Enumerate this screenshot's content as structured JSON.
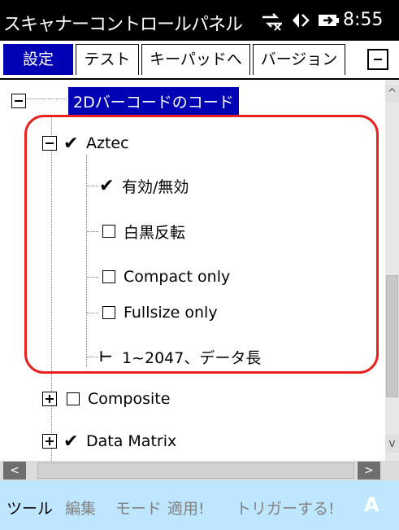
{
  "titlebar": {
    "title": "スキャナーコントロールパネル",
    "time": "8:55",
    "icons": [
      "connectivity-icon",
      "volume-icon",
      "battery-icon"
    ]
  },
  "tabs": [
    {
      "label": "設定",
      "active": true
    },
    {
      "label": "テスト",
      "active": false
    },
    {
      "label": "キーパッドへ",
      "active": false
    },
    {
      "label": "バージョン",
      "active": false
    }
  ],
  "tree": {
    "root": {
      "label": "2Dバーコードのコード",
      "selected": true
    },
    "aztec": {
      "label": "Aztec",
      "checked": true,
      "children": [
        {
          "label": "有効/無効",
          "checked": true
        },
        {
          "label": "白黒反転",
          "checked": false
        },
        {
          "label": "Compact only",
          "checked": false
        },
        {
          "label": "Fullsize only",
          "checked": false
        },
        {
          "label": "1~2047、データ長",
          "type": "range"
        }
      ]
    },
    "composite": {
      "label": "Composite",
      "checked": false
    },
    "data_matrix": {
      "label": "Data Matrix",
      "checked": true
    }
  },
  "menubar": {
    "items": [
      "ツール",
      "編集",
      "モード",
      "適用!",
      "トリガーする!"
    ],
    "input_indicator": "A"
  },
  "colors": {
    "highlight": "#e8201e",
    "selection": "#0000b4",
    "menubar": "#bfe6ff"
  }
}
